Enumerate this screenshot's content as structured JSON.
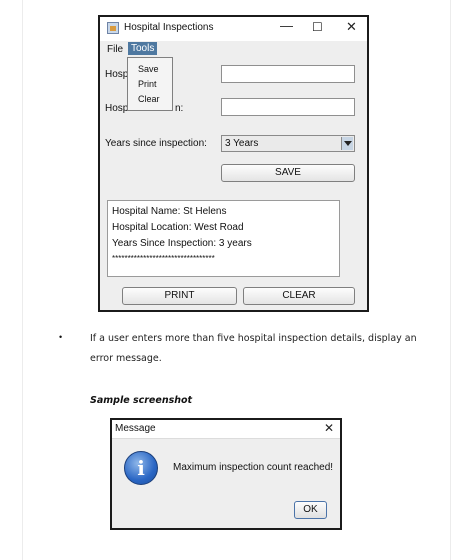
{
  "app_window": {
    "title": "Hospital Inspections",
    "controls": {
      "minimize": "—",
      "maximize": "☐",
      "close": "✕"
    },
    "menu": {
      "file": "File",
      "tools": "Tools"
    },
    "tools_menu_items": [
      "Save",
      "Print",
      "Clear"
    ],
    "form": {
      "hospital_name_label_visible": "Hosp",
      "hospital_location_label_visible": "Hosp",
      "hospital_location_label_tail": "n:",
      "hospital_name_value": "",
      "hospital_location_value": "",
      "years_label": "Years since inspection:",
      "years_selected": "3 Years",
      "save_button": "SAVE"
    },
    "output_lines": [
      "Hospital Name: St Helens",
      "Hospital Location: West Road",
      "Years Since Inspection: 3 years",
      "*********************************"
    ],
    "print_button": "PRINT",
    "clear_button": "CLEAR"
  },
  "document": {
    "bullet": "•",
    "requirement_text": "If a user enters more than five hospital inspection details, display an error message.",
    "caption": "Sample screenshot"
  },
  "message_dialog": {
    "title": "Message",
    "close": "✕",
    "icon": "info-icon",
    "icon_glyph": "i",
    "message": "Maximum inspection count reached!",
    "ok_button": "OK"
  }
}
